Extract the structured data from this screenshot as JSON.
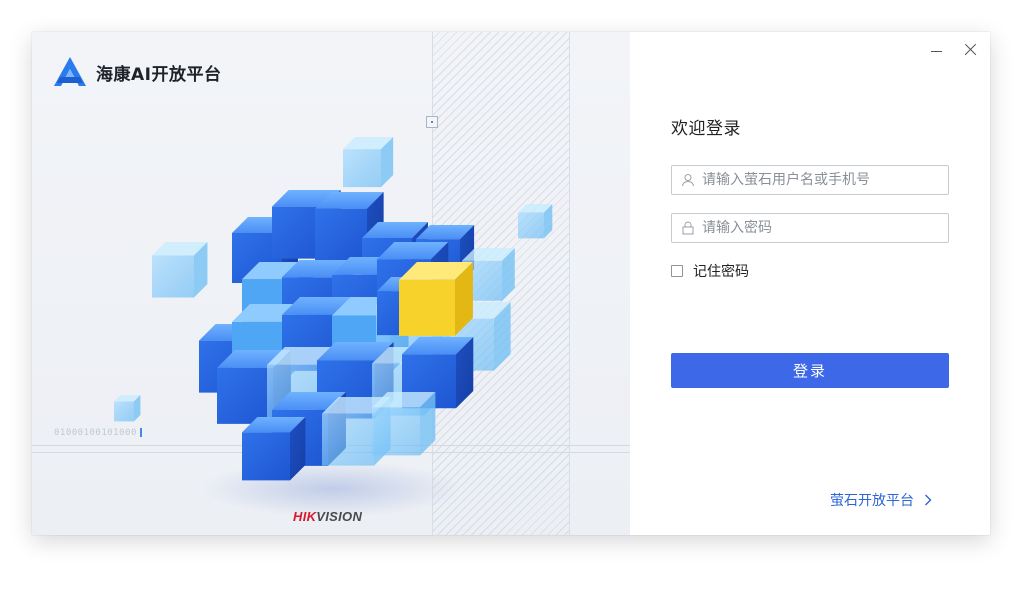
{
  "app": {
    "title": "海康AI开放平台",
    "brand_color": "#2b7bef"
  },
  "left_panel": {
    "binary_text": "01000100101000",
    "footer_logo": {
      "prefix": "HIK",
      "suffix": "VISION",
      "prefix_color": "#d7192e",
      "suffix_color": "#4a4a4a"
    }
  },
  "window_controls": {
    "minimize_icon": "minimize-icon",
    "close_icon": "close-icon"
  },
  "login": {
    "heading": "欢迎登录",
    "username": {
      "placeholder": "请输入萤石用户名或手机号",
      "value": "",
      "icon": "user-icon"
    },
    "password": {
      "placeholder": "请输入密码",
      "value": "",
      "icon": "lock-icon"
    },
    "remember": {
      "label": "记住密码",
      "checked": false
    },
    "submit_label": "登录",
    "submit_color": "#3d69e8",
    "platform_link": "萤石开放平台",
    "platform_link_color": "#2e64d7"
  }
}
